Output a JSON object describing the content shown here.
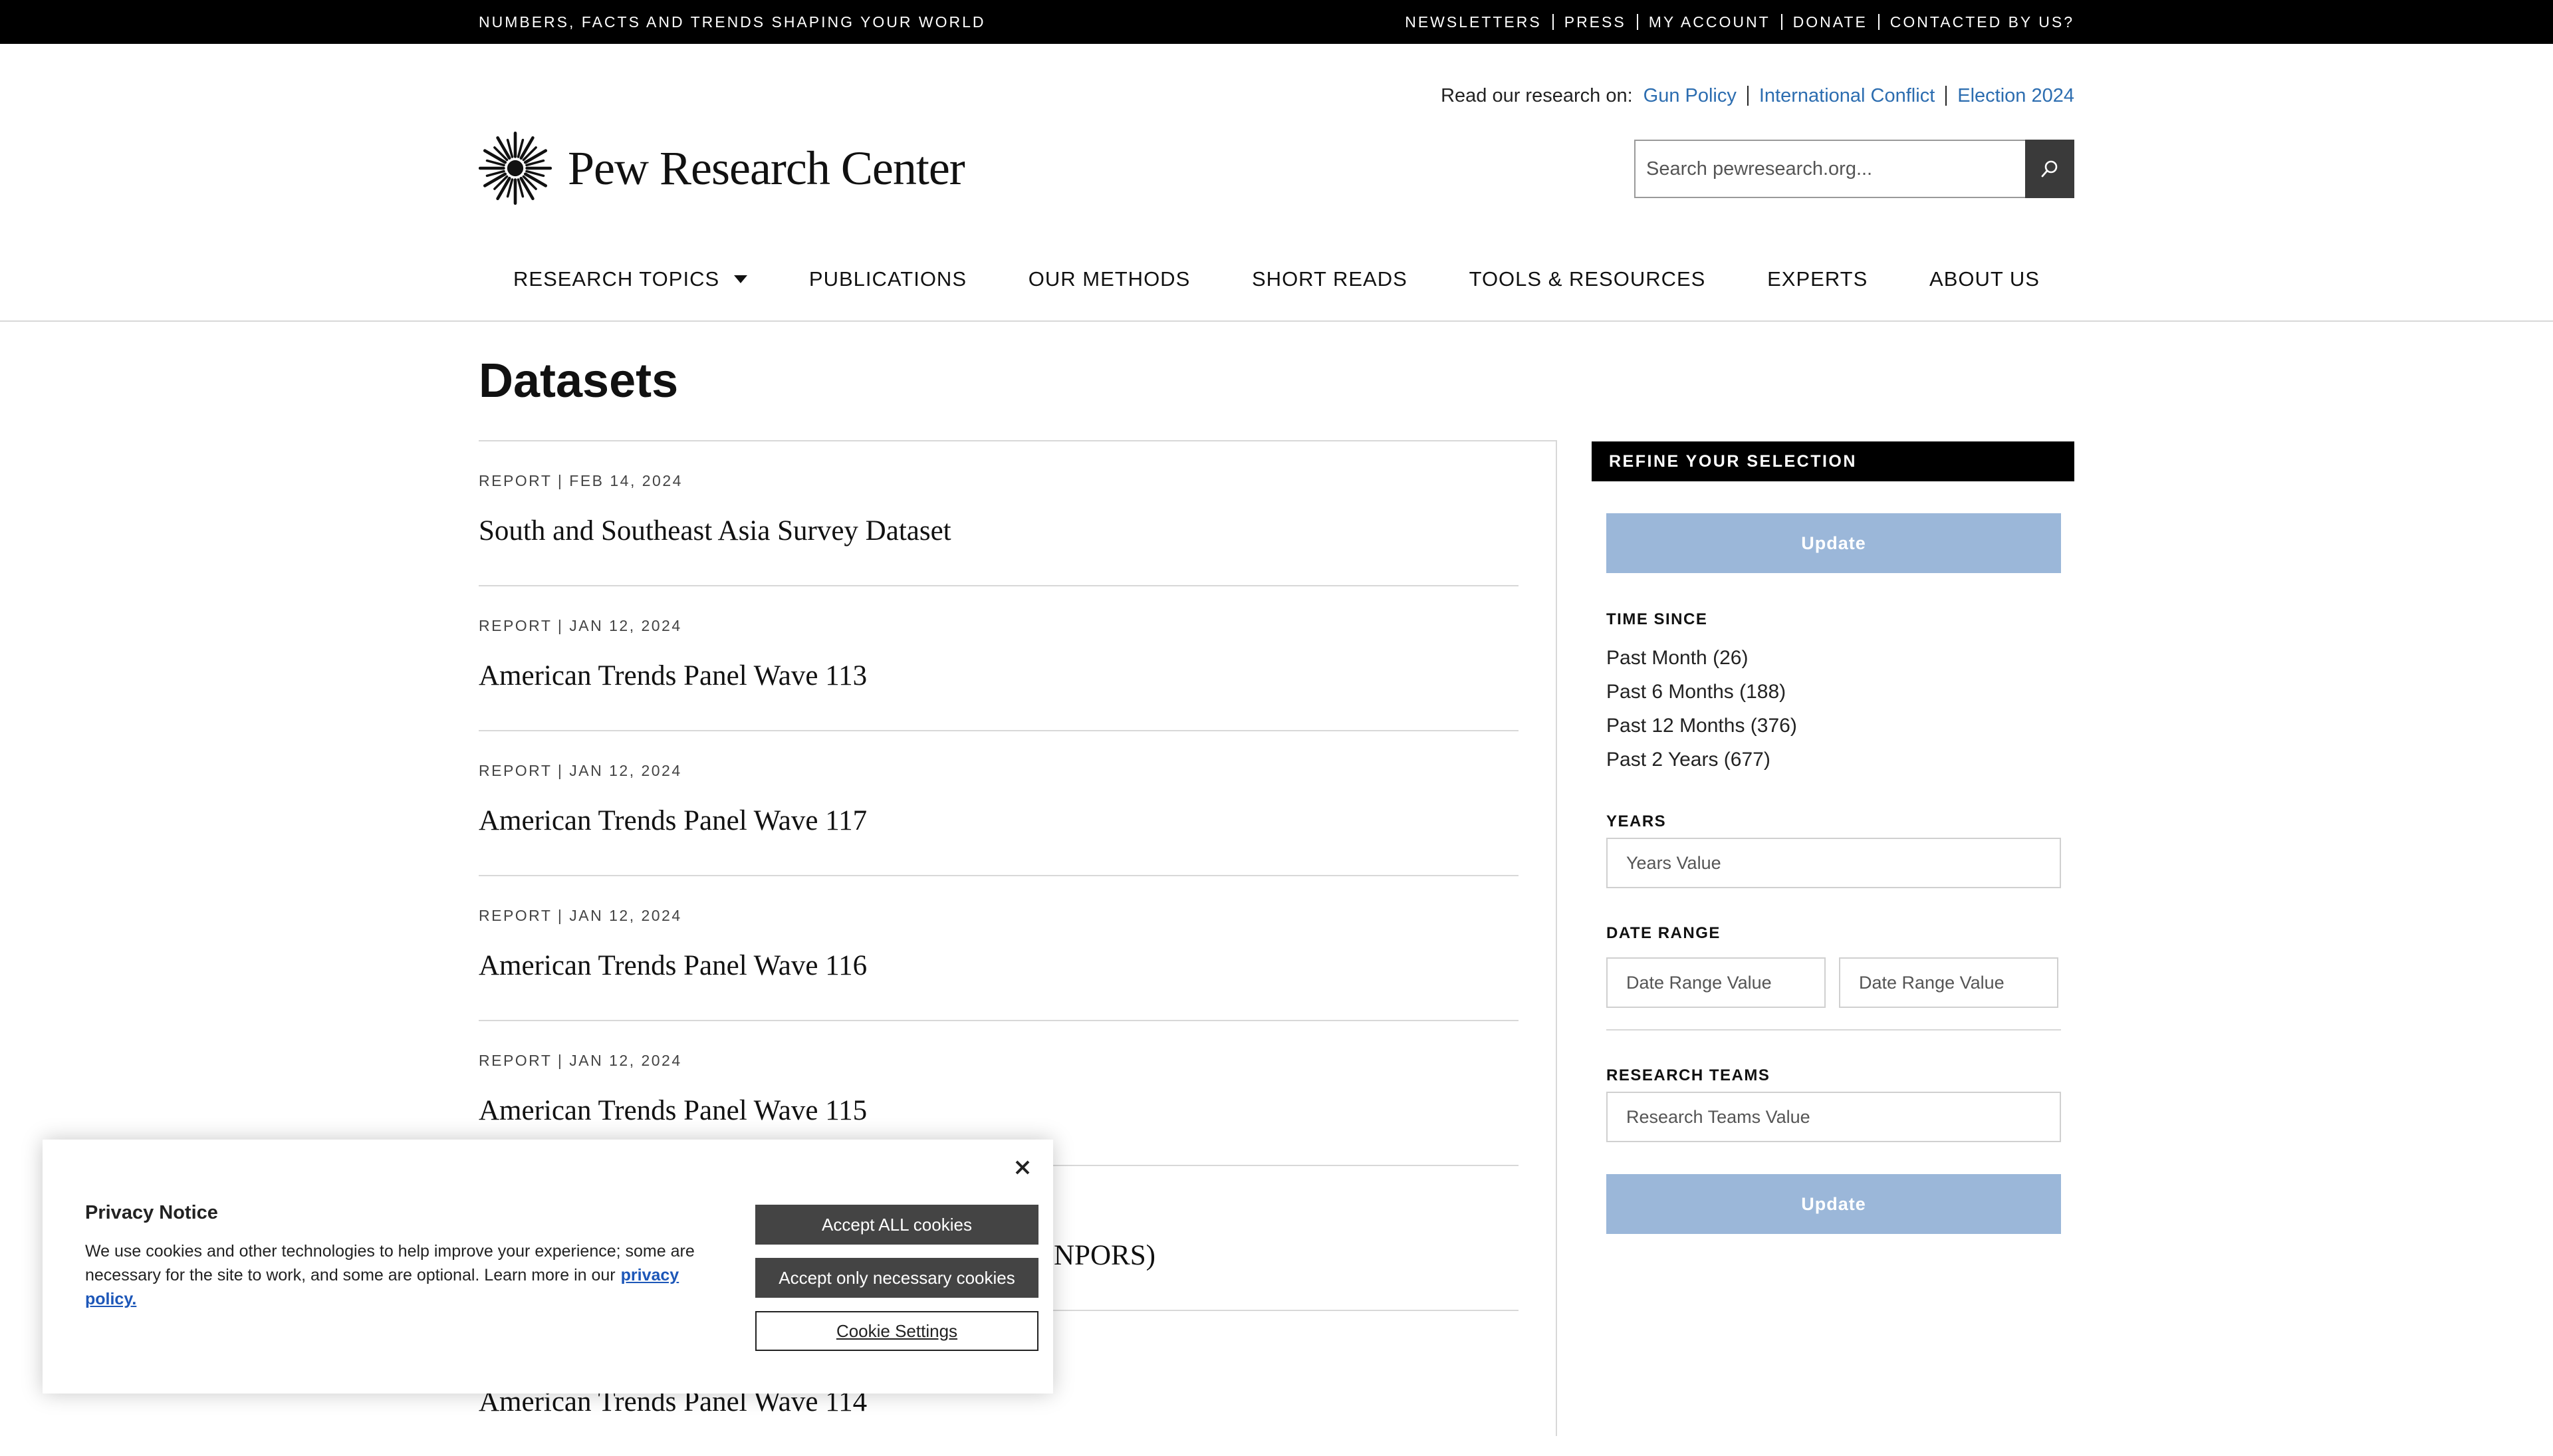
{
  "topbar": {
    "tagline": "NUMBERS, FACTS AND TRENDS SHAPING YOUR WORLD",
    "links": [
      "NEWSLETTERS",
      "PRESS",
      "MY ACCOUNT",
      "DONATE",
      "CONTACTED BY US?"
    ]
  },
  "header": {
    "research_lead": "Read our research on:",
    "research_links": [
      "Gun Policy",
      "International Conflict",
      "Election 2024"
    ],
    "logo_text": "Pew Research Center",
    "search_placeholder": "Search pewresearch.org..."
  },
  "nav": {
    "items": [
      "RESEARCH TOPICS",
      "PUBLICATIONS",
      "OUR METHODS",
      "SHORT READS",
      "TOOLS & RESOURCES",
      "EXPERTS",
      "ABOUT US"
    ]
  },
  "page": {
    "title": "Datasets"
  },
  "results": [
    {
      "meta": "REPORT | FEB 14, 2024",
      "title": "South and Southeast Asia Survey Dataset"
    },
    {
      "meta": "REPORT | JAN 12, 2024",
      "title": "American Trends Panel Wave 113"
    },
    {
      "meta": "REPORT | JAN 12, 2024",
      "title": "American Trends Panel Wave 117"
    },
    {
      "meta": "REPORT | JAN 12, 2024",
      "title": "American Trends Panel Wave 116"
    },
    {
      "meta": "REPORT | JAN 12, 2024",
      "title": "American Trends Panel Wave 115"
    },
    {
      "meta": "",
      "title": "NPORS)"
    },
    {
      "meta": "",
      "title": "American Trends Panel Wave 114"
    }
  ],
  "sidebar": {
    "header": "REFINE YOUR SELECTION",
    "update_label": "Update",
    "time_since": {
      "label": "TIME SINCE",
      "options": [
        "Past Month (26)",
        "Past 6 Months (188)",
        "Past 12 Months (376)",
        "Past 2 Years (677)"
      ]
    },
    "years": {
      "label": "YEARS",
      "placeholder": "Years Value"
    },
    "date_range": {
      "label": "DATE RANGE",
      "start_placeholder": "Date Range Value",
      "end_placeholder": "Date Range Value"
    },
    "research_teams": {
      "label": "RESEARCH TEAMS",
      "placeholder": "Research Teams Value"
    }
  },
  "cookie": {
    "title": "Privacy Notice",
    "text": "We use cookies and other technologies to help improve your experience; some are necessary for the site to work, and some are optional. Learn more in our",
    "link": "privacy policy.",
    "accept_all": "Accept ALL cookies",
    "accept_necessary": "Accept only necessary cookies",
    "settings": "Cookie Settings"
  },
  "colors": {
    "link": "#2c6db0",
    "update_button": "#9bb7d9",
    "topbar": "#000000",
    "cookie_button": "#444444"
  }
}
